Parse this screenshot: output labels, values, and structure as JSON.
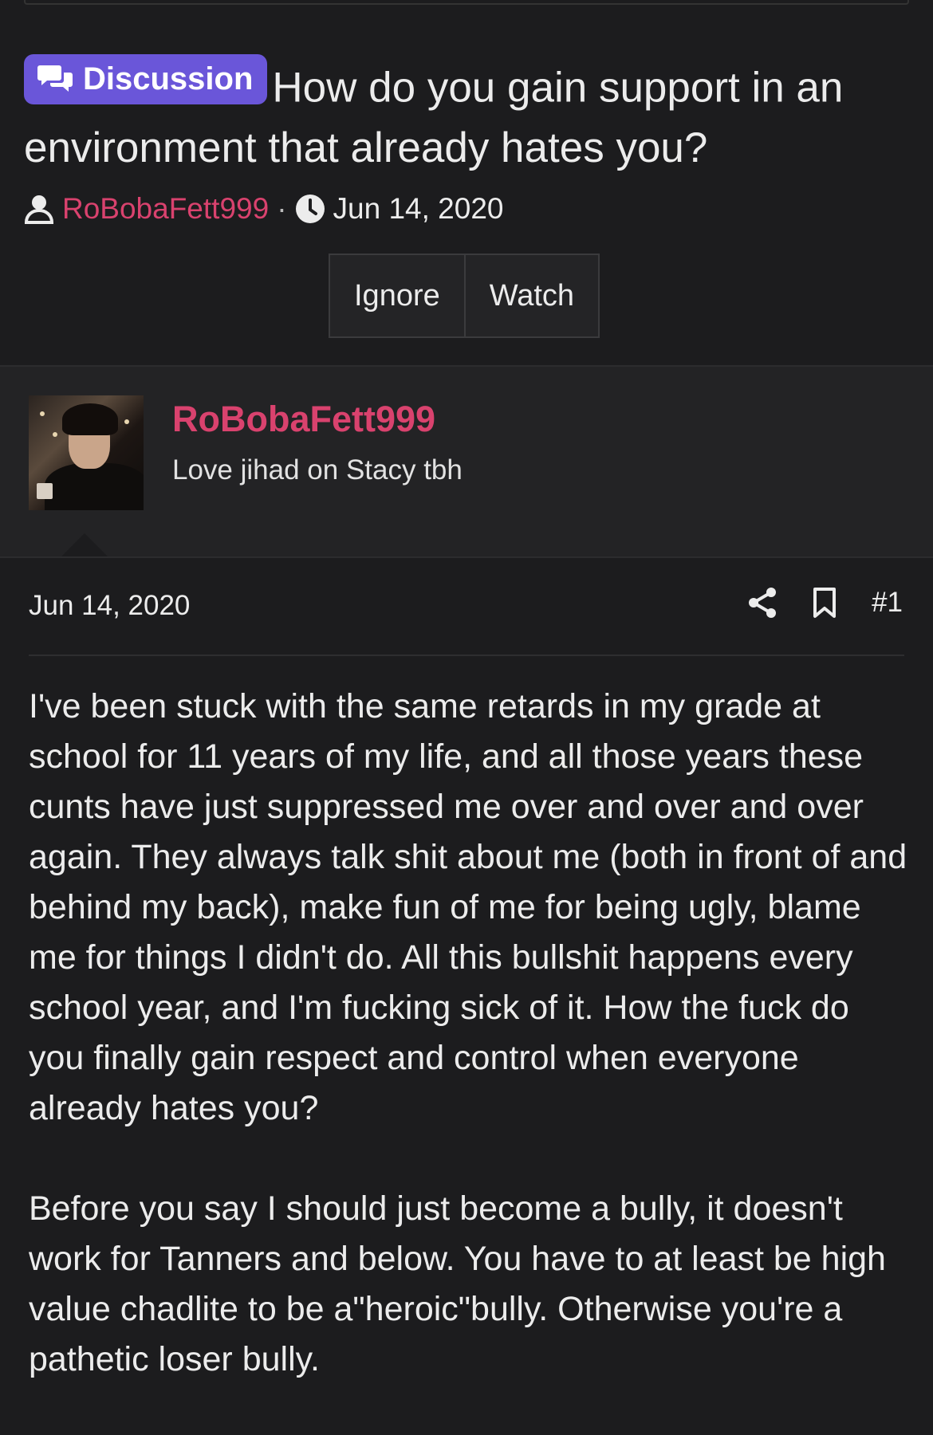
{
  "thread": {
    "prefix_label": "Discussion",
    "title": "How do you gain support in an environment that already hates you?",
    "author": "RoBobaFett999",
    "separator": "·",
    "date": "Jun 14, 2020",
    "buttons": {
      "ignore": "Ignore",
      "watch": "Watch"
    }
  },
  "user": {
    "name": "RoBobaFett999",
    "title": "Love jihad on Stacy tbh"
  },
  "post": {
    "date": "Jun 14, 2020",
    "number": "#1",
    "paragraphs": [
      "I've been stuck with the same retards in my grade at school for 11 years of my life, and all those years these cunts have just suppressed me over and over and over again. They always talk shit about me (both in front of and behind my back), make fun of me for being ugly, blame me for things I didn't do. All this bullshit happens every school year, and I'm fucking sick of it. How the fuck do you finally gain respect and control when everyone already hates you?",
      "Before you say I should just become a bully, it doesn't work for Tanners and below. You have to at least be high value chadlite to be a\"heroic\"bully. Otherwise you're a pathetic loser bully."
    ]
  },
  "colors": {
    "background": "#1c1c1e",
    "userbar": "#232325",
    "accent_link": "#d9426e",
    "prefix_bg": "#6a56d9"
  }
}
